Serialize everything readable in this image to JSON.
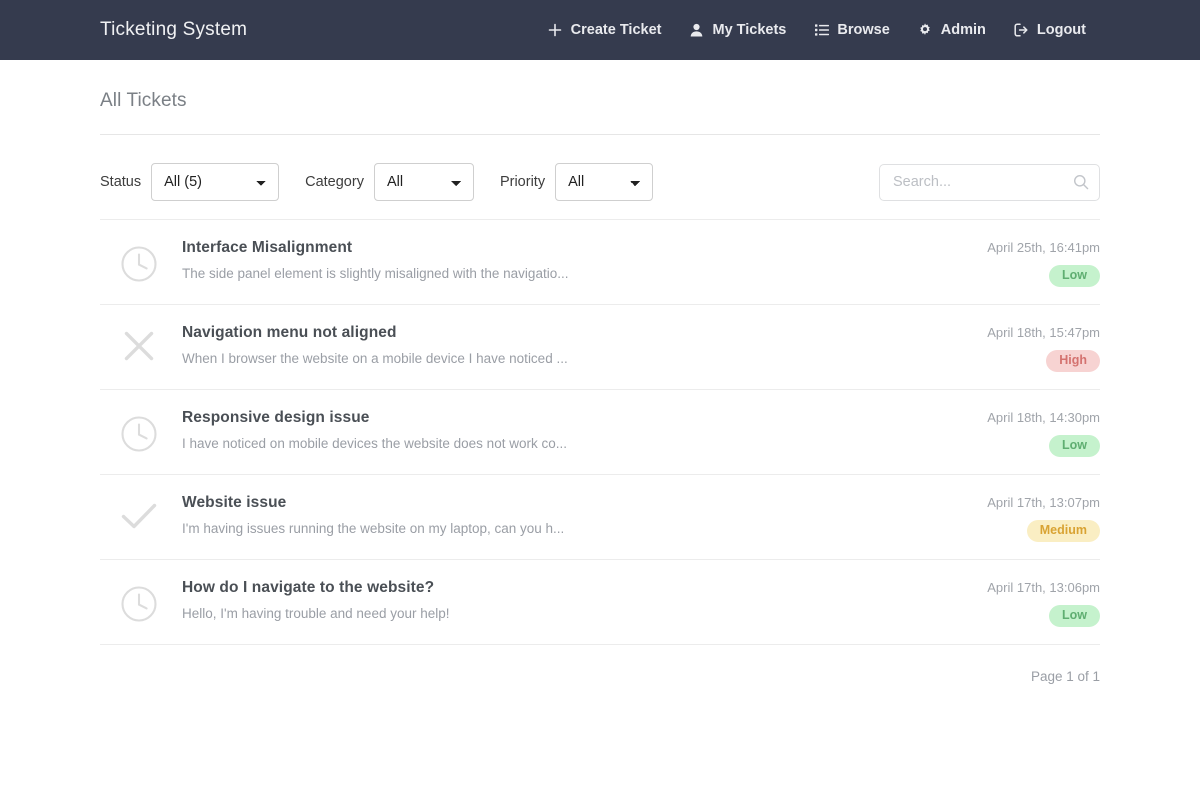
{
  "navbar": {
    "brand": "Ticketing System",
    "links": [
      {
        "label": "Create Ticket",
        "icon": "plus-icon"
      },
      {
        "label": "My Tickets",
        "icon": "user-icon"
      },
      {
        "label": "Browse",
        "icon": "list-icon"
      },
      {
        "label": "Admin",
        "icon": "gear-icon"
      },
      {
        "label": "Logout",
        "icon": "logout-icon"
      }
    ]
  },
  "page": {
    "title": "All Tickets"
  },
  "filters": {
    "status": {
      "label": "Status",
      "value": "All (5)"
    },
    "category": {
      "label": "Category",
      "value": "All"
    },
    "priority": {
      "label": "Priority",
      "value": "All"
    }
  },
  "search": {
    "placeholder": "Search...",
    "value": "",
    "icon": "search-icon"
  },
  "tickets": [
    {
      "status_icon": "clock-icon",
      "title": "Interface Misalignment",
      "description": "The side panel element is slightly misaligned with the navigatio...",
      "date": "April 25th, 16:41pm",
      "priority": "Low",
      "priority_class": "badge-low"
    },
    {
      "status_icon": "close-icon",
      "title": "Navigation menu not aligned",
      "description": "When I browser the website on a mobile device I have noticed ...",
      "date": "April 18th, 15:47pm",
      "priority": "High",
      "priority_class": "badge-high"
    },
    {
      "status_icon": "clock-icon",
      "title": "Responsive design issue",
      "description": "I have noticed on mobile devices the website does not work co...",
      "date": "April 18th, 14:30pm",
      "priority": "Low",
      "priority_class": "badge-low"
    },
    {
      "status_icon": "check-icon",
      "title": "Website issue",
      "description": "I'm having issues running the website on my laptop, can you h...",
      "date": "April 17th, 13:07pm",
      "priority": "Medium",
      "priority_class": "badge-medium"
    },
    {
      "status_icon": "clock-icon",
      "title": "How do I navigate to the website?",
      "description": "Hello, I'm having trouble and need your help!",
      "date": "April 17th, 13:06pm",
      "priority": "Low",
      "priority_class": "badge-low"
    }
  ],
  "pagination": {
    "text": "Page 1 of 1"
  },
  "colors": {
    "navbar_bg": "#353b4e",
    "navbar_text": "#e9eaee",
    "title_text": "#7b8086",
    "ticket_title": "#4a4f55",
    "muted_text": "#9a9ea5",
    "status_icon": "#dcdcdc",
    "low_bg": "#c5f2cd",
    "low_text": "#5fae71",
    "high_bg": "#f7d3d2",
    "high_text": "#d4726f",
    "medium_bg": "#faeec3",
    "medium_text": "#d9a333"
  }
}
